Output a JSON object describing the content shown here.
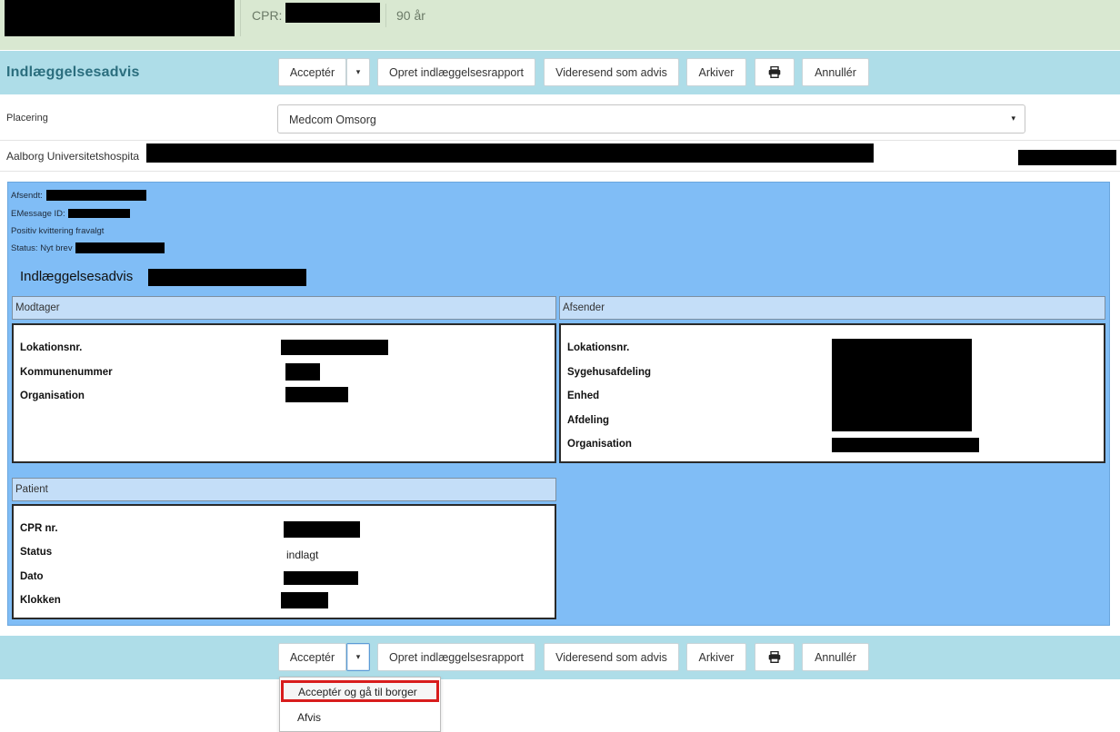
{
  "header": {
    "cpr_label": "CPR:",
    "age": "90 år"
  },
  "toolbar": {
    "title": "Indlæggelsesadvis",
    "accept": "Acceptér",
    "caret": "▾",
    "create_report": "Opret indlæggelsesrapport",
    "forward": "Videresend som advis",
    "archive": "Arkiver",
    "print_icon": "print-icon",
    "cancel": "Annullér"
  },
  "placement": {
    "label": "Placering",
    "value": "Medcom Omsorg",
    "arrow": "▾"
  },
  "hospital": {
    "name": "Aalborg Universitetshospita"
  },
  "message": {
    "sent_label": "Afsendt:",
    "emessage_label": "EMessage ID:",
    "receipt_text": "Positiv kvittering fravalgt",
    "status_label": "Status: Nyt brev",
    "title": "Indlæggelsesadvis",
    "receiver": {
      "header": "Modtager",
      "labels": [
        "Lokationsnr.",
        "Kommunenummer",
        "Organisation"
      ]
    },
    "sender": {
      "header": "Afsender",
      "labels": [
        "Lokationsnr.",
        "Sygehusafdeling",
        "Enhed",
        "Afdeling",
        "Organisation"
      ]
    },
    "patient": {
      "header": "Patient",
      "labels": [
        "CPR nr.",
        "Status",
        "Dato",
        "Klokken"
      ],
      "status_value": "indlagt"
    }
  },
  "accept_menu": {
    "items": [
      "Acceptér og gå til borger",
      "Afvis"
    ]
  },
  "colors": {
    "header_bg": "#d9e8d1",
    "toolbar_bg": "#aedde8",
    "panel_bg": "#80bdf6",
    "section_header_bg": "#c4def8",
    "highlight_border": "#d81c1c"
  }
}
